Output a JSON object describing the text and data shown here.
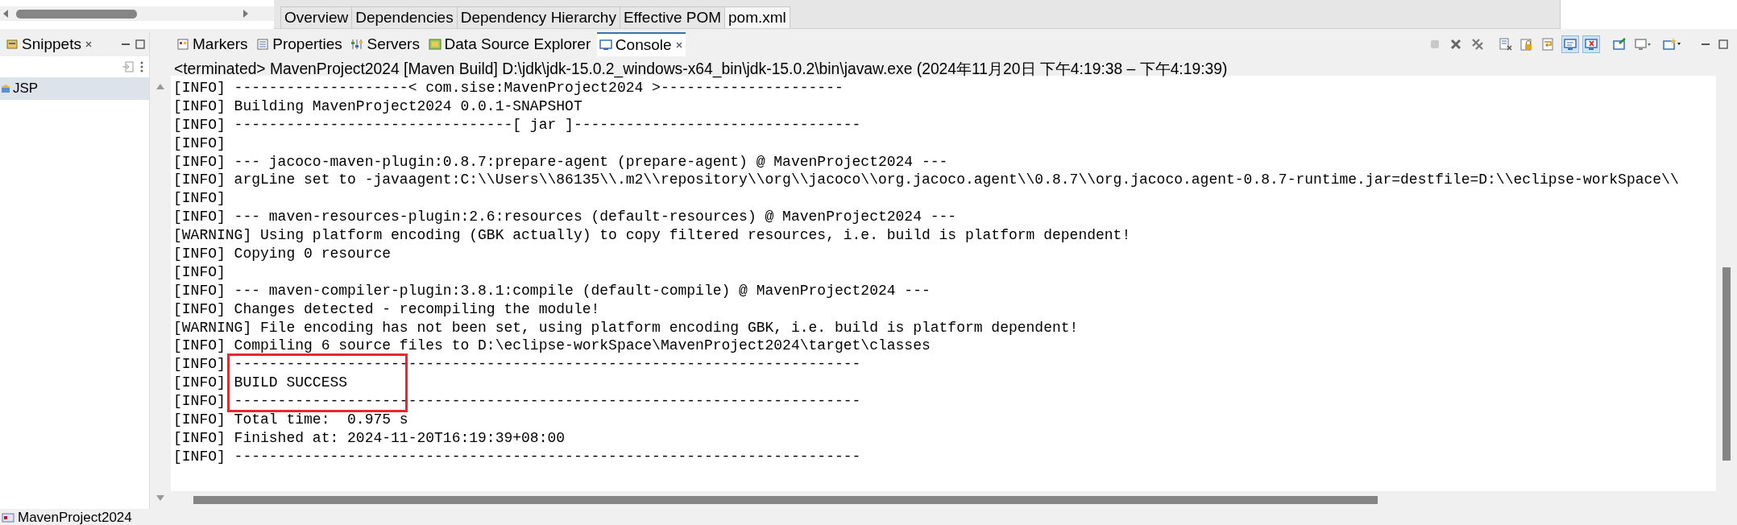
{
  "editor_tabs": [
    {
      "label": "Overview",
      "selected": false
    },
    {
      "label": "Dependencies",
      "selected": false
    },
    {
      "label": "Dependency Hierarchy",
      "selected": false
    },
    {
      "label": "Effective POM",
      "selected": false
    },
    {
      "label": "pom.xml",
      "selected": true
    }
  ],
  "snippets_view": {
    "title": "Snippets",
    "items": [
      {
        "label": "JSP",
        "selected": true
      }
    ]
  },
  "console_view": {
    "tabs": [
      {
        "kind": "markers",
        "label": "Markers",
        "selected": false
      },
      {
        "kind": "properties",
        "label": "Properties",
        "selected": false
      },
      {
        "kind": "servers",
        "label": "Servers",
        "selected": false
      },
      {
        "kind": "datasource",
        "label": "Data Source Explorer",
        "selected": false
      },
      {
        "kind": "console",
        "label": "Console",
        "selected": true
      }
    ],
    "toolbar": [
      {
        "kind": "stop",
        "selected": false,
        "disabled": true
      },
      {
        "kind": "remove",
        "selected": false,
        "disabled": false
      },
      {
        "kind": "remove-all",
        "selected": false,
        "disabled": false
      },
      {
        "kind": "clear",
        "selected": false,
        "disabled": false
      },
      {
        "kind": "lock",
        "selected": false,
        "disabled": false
      },
      {
        "kind": "wrap",
        "selected": false,
        "disabled": false
      },
      {
        "kind": "stdout",
        "selected": true,
        "disabled": false
      },
      {
        "kind": "stderr",
        "selected": true,
        "disabled": false
      },
      {
        "kind": "pin",
        "selected": false,
        "disabled": false
      },
      {
        "kind": "display",
        "selected": false,
        "disabled": false
      },
      {
        "kind": "new",
        "selected": false,
        "disabled": false
      }
    ],
    "process": "<terminated> MavenProject2024 [Maven Build] D:\\jdk\\jdk-15.0.2_windows-x64_bin\\jdk-15.0.2\\bin\\javaw.exe  (2024年11月20日 下午4:19:38 – 下午4:19:39)",
    "lines": [
      {
        "text": "[INFO] --------------------< com.sise:MavenProject2024 >---------------------",
        "boxed": false
      },
      {
        "text": "[INFO] Building MavenProject2024 0.0.1-SNAPSHOT",
        "boxed": false
      },
      {
        "text": "[INFO] --------------------------------[ jar ]---------------------------------",
        "boxed": false
      },
      {
        "text": "[INFO]",
        "boxed": false
      },
      {
        "text": "[INFO] --- jacoco-maven-plugin:0.8.7:prepare-agent (prepare-agent) @ MavenProject2024 ---",
        "boxed": false
      },
      {
        "text": "[INFO] argLine set to -javaagent:C:\\\\Users\\\\86135\\\\.m2\\\\repository\\\\org\\\\jacoco\\\\org.jacoco.agent\\\\0.8.7\\\\org.jacoco.agent-0.8.7-runtime.jar=destfile=D:\\\\eclipse-workSpace\\\\",
        "boxed": false
      },
      {
        "text": "[INFO]",
        "boxed": false
      },
      {
        "text": "[INFO] --- maven-resources-plugin:2.6:resources (default-resources) @ MavenProject2024 ---",
        "boxed": false
      },
      {
        "text": "[WARNING] Using platform encoding (GBK actually) to copy filtered resources, i.e. build is platform dependent!",
        "boxed": false
      },
      {
        "text": "[INFO] Copying 0 resource",
        "boxed": false
      },
      {
        "text": "[INFO]",
        "boxed": false
      },
      {
        "text": "[INFO] --- maven-compiler-plugin:3.8.1:compile (default-compile) @ MavenProject2024 ---",
        "boxed": false
      },
      {
        "text": "[INFO] Changes detected - recompiling the module!",
        "boxed": false
      },
      {
        "text": "[WARNING] File encoding has not been set, using platform encoding GBK, i.e. build is platform dependent!",
        "boxed": false
      },
      {
        "text": "[INFO] Compiling 6 source files to D:\\eclipse-workSpace\\MavenProject2024\\target\\classes",
        "boxed": false
      },
      {
        "text": "[INFO] ------------------------------------------------------------------------",
        "boxed": true
      },
      {
        "text": "[INFO] BUILD SUCCESS",
        "boxed": true
      },
      {
        "text": "[INFO] ------------------------------------------------------------------------",
        "boxed": true
      },
      {
        "text": "[INFO] Total time:  0.975 s",
        "boxed": false
      },
      {
        "text": "[INFO] Finished at: 2024-11-20T16:19:39+08:00",
        "boxed": false
      },
      {
        "text": "[INFO] ------------------------------------------------------------------------",
        "boxed": false
      }
    ]
  },
  "status_bar": {
    "text": "MavenProject2024"
  }
}
